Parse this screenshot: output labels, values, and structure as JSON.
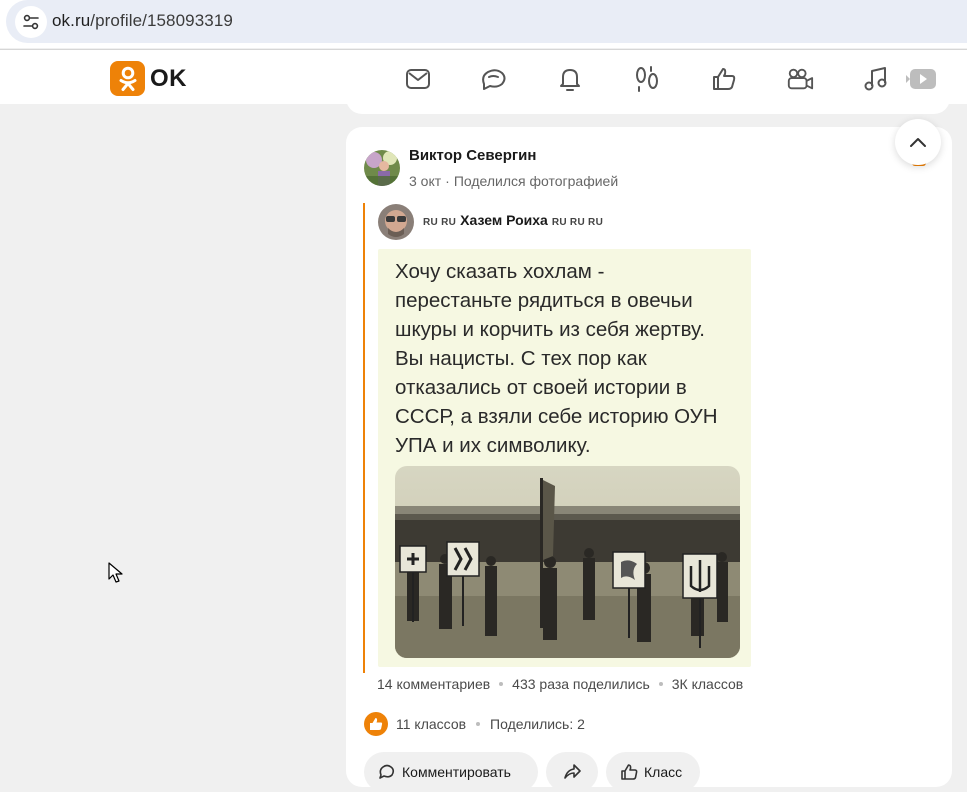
{
  "browser": {
    "url_host": "ok.ru",
    "url_path": "/profile/158093319"
  },
  "header": {
    "logo_text": "OK",
    "nav_icons": [
      "mail-icon",
      "chat-bubbles-icon",
      "bell-icon",
      "footprints-icon",
      "thumbs-up-icon",
      "video-camera-icon",
      "music-note-icon",
      "video-play-icon"
    ]
  },
  "colors": {
    "brand": "#ee8208",
    "page_bg": "#f0f0f0",
    "card_bg": "#ffffff",
    "url_bar": "#e9edf6"
  },
  "post": {
    "author": "Виктор Севергин",
    "date": "3 окт",
    "action": "Поделился фотографией",
    "repost": {
      "tag_prefix": "RU RU",
      "author": "Хазем Роиха",
      "tag_suffix": "RU RU RU",
      "image_text_lines": [
        "Хочу сказать хохлам -",
        "перестаньте рядиться в овечьи",
        "шкуры и корчить из себя жертву.",
        "Вы нацисты. С тех пор как",
        "отказались от своей истории в",
        "СССР, а взяли себе историю ОУН",
        "УПА и их символику."
      ],
      "stats": {
        "comments": "14 комментариев",
        "shares": "433 раза поделились",
        "likes": "3К классов"
      }
    },
    "stats": {
      "likes": "11 классов",
      "shares": "Поделились: 2"
    },
    "actions": {
      "comment": "Комментировать",
      "like": "Класс"
    }
  }
}
